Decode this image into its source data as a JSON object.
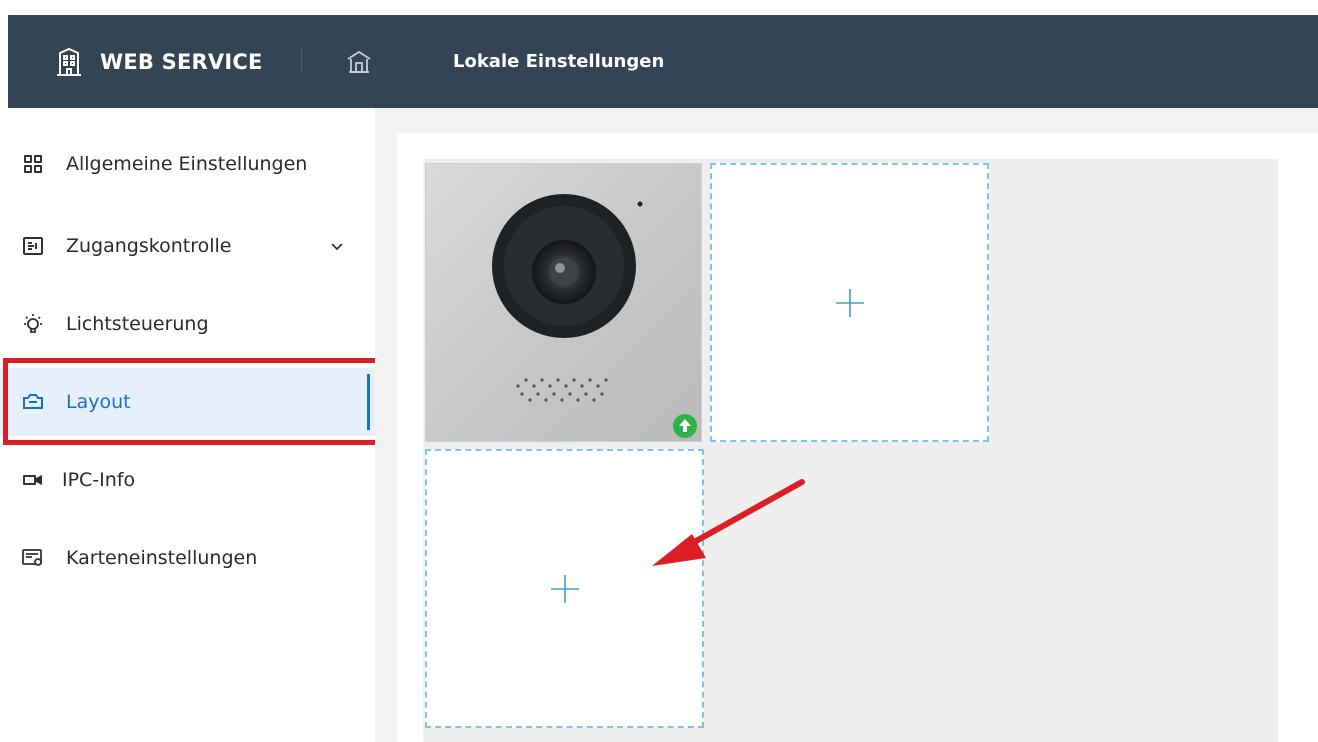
{
  "header": {
    "brand_text": "WEB SERVICE",
    "brand_icon": "building-icon",
    "home_icon": "home-icon",
    "page_title": "Lokale Einstellungen",
    "background_color": "#334554"
  },
  "sidebar": {
    "active_color": "#1a6fc9",
    "highlight_color": "#dc1f26",
    "items": [
      {
        "label": "Allgemeine Einstellungen",
        "icon": "grid-icon"
      },
      {
        "label": "Zugangskontrolle",
        "icon": "access-control-icon",
        "expandable": true
      },
      {
        "label": "Lichtsteuerung",
        "icon": "light-bulb-icon"
      },
      {
        "label": "Layout",
        "icon": "layout-icon",
        "active": true
      },
      {
        "label": "IPC-Info",
        "icon": "camera-icon"
      },
      {
        "label": "Karteneinstellungen",
        "icon": "card-settings-icon"
      }
    ]
  },
  "layout_grid": {
    "slots": [
      {
        "type": "device-image",
        "badge_icon": "upload-icon"
      },
      {
        "type": "add",
        "icon": "plus-icon"
      },
      {
        "type": "add",
        "icon": "plus-icon"
      }
    ],
    "annotation_arrow_color": "#dc1f26",
    "slot_border_color": "#7ec5e3"
  }
}
